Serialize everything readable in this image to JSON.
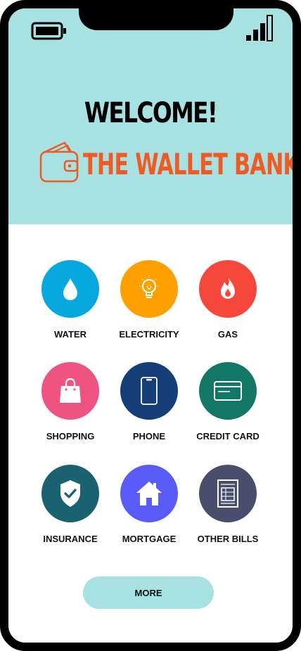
{
  "header": {
    "welcome": "WELCOME!",
    "brand_name": "THE WALLET BANK",
    "brand_icon": "wallet-icon",
    "status_icons": [
      "battery-icon",
      "signal-icon"
    ]
  },
  "services": [
    {
      "label": "WATER",
      "icon": "water-drop-icon",
      "color": "#07a8e0"
    },
    {
      "label": "ELECTRICITY",
      "icon": "light-bulb-icon",
      "color": "#ff9f00"
    },
    {
      "label": "GAS",
      "icon": "flame-icon",
      "color": "#f5473c"
    },
    {
      "label": "SHOPPING",
      "icon": "shopping-bag-icon",
      "color": "#ef5381"
    },
    {
      "label": "PHONE",
      "icon": "smartphone-icon",
      "color": "#173f77"
    },
    {
      "label": "CREDIT CARD",
      "icon": "credit-card-icon",
      "color": "#137765"
    },
    {
      "label": "INSURANCE",
      "icon": "shield-check-icon",
      "color": "#1a6272"
    },
    {
      "label": "MORTGAGE",
      "icon": "house-icon",
      "color": "#5a5cf8"
    },
    {
      "label": "OTHER BILLS",
      "icon": "bill-document-icon",
      "color": "#4a4d6b"
    }
  ],
  "more_label": "MORE",
  "colors": {
    "header_bg": "#a7e1e1",
    "brand": "#ef5a25",
    "more_button_bg": "#a7e1e1"
  }
}
